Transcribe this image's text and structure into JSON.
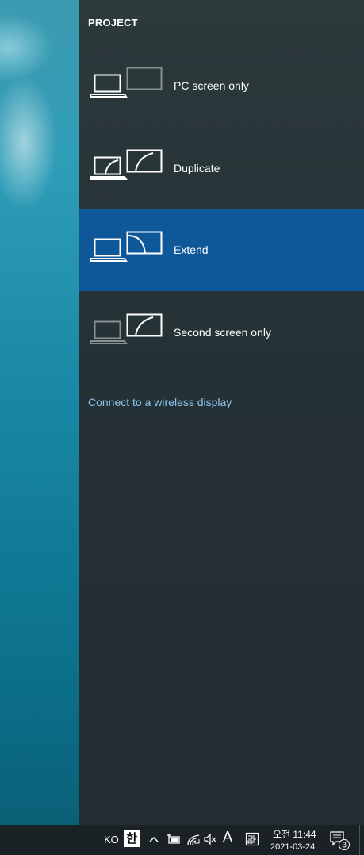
{
  "pane": {
    "title": "PROJECT",
    "options": [
      {
        "label": "PC screen only",
        "icon": "pc-screen-only-icon",
        "selected": false
      },
      {
        "label": "Duplicate",
        "icon": "duplicate-icon",
        "selected": false
      },
      {
        "label": "Extend",
        "icon": "extend-icon",
        "selected": true
      },
      {
        "label": "Second screen only",
        "icon": "second-screen-only-icon",
        "selected": false
      }
    ],
    "connect_link": "Connect to a wireless display"
  },
  "taskbar": {
    "language": "KO",
    "ime_mode": "한",
    "font_indicator": "A",
    "time": "오전 11:44",
    "date": "2021-03-24",
    "notification_count": "3"
  },
  "colors": {
    "selected_bg": "#0e5799",
    "link": "#8cc6f0",
    "pane_bg": "#222c32"
  }
}
